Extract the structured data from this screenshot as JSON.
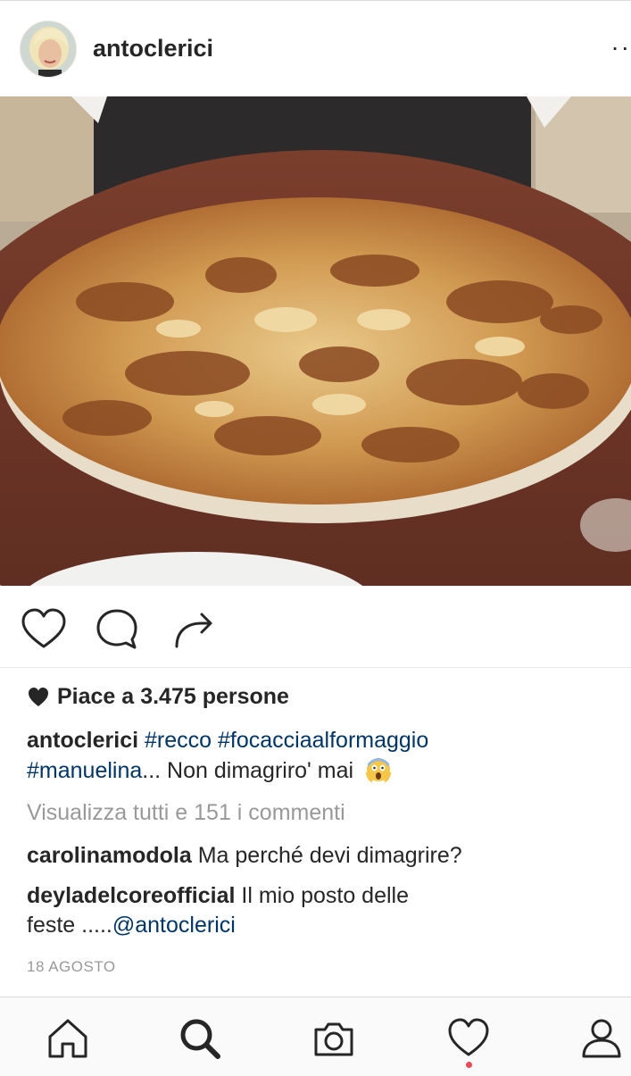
{
  "post": {
    "username": "antoclerici",
    "more_label": "··",
    "photo_alt": "focaccia al formaggio"
  },
  "actions": {
    "like_icon": "heart-outline-icon",
    "comment_icon": "comment-icon",
    "share_icon": "share-arrow-icon"
  },
  "likes": {
    "prefix": "Piace a",
    "text": "3.475 persone"
  },
  "caption": {
    "username": "antoclerici",
    "hashtag1": "#recco",
    "hashtag2": "#focacciaalformaggio",
    "hashtag3": "#manuelina",
    "text": "... Non dimagriro' mai",
    "emoji": "scream-emoji"
  },
  "comments": {
    "view_all": "Visualizza tutti e 151 i commenti",
    "items": [
      {
        "username": "carolinamodola",
        "text": "Ma perché devi dimagrire?"
      },
      {
        "username": "deyladelcoreofficial",
        "text": "Il mio posto delle",
        "text2": "feste .....",
        "mention": "@antoclerici"
      }
    ]
  },
  "date": "18 AGOSTO",
  "tabbar": {
    "items": [
      "home-icon",
      "search-icon",
      "camera-icon",
      "activity-heart-icon",
      "profile-icon"
    ],
    "notification_color": "#ed4956"
  },
  "colors": {
    "link": "#003569",
    "muted": "#999999",
    "text": "#262626"
  }
}
